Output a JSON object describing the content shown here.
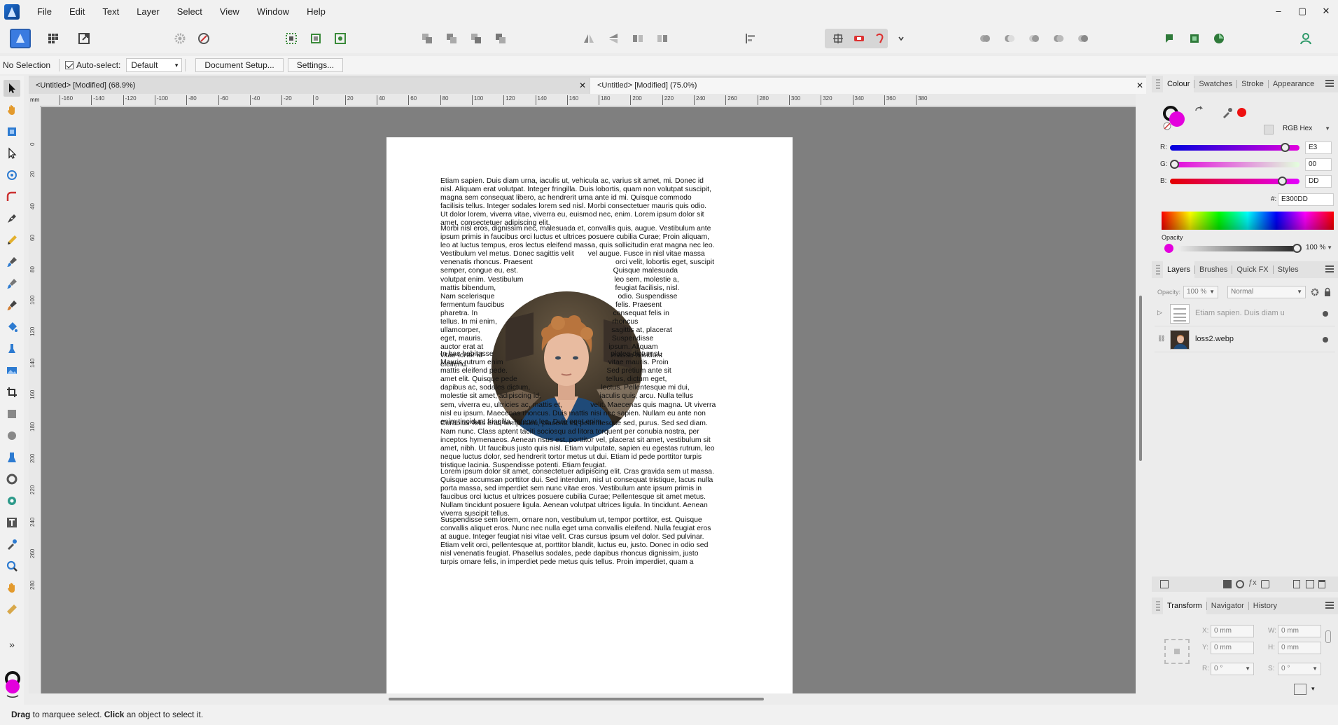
{
  "menubar": {
    "items": [
      "File",
      "Edit",
      "Text",
      "Layer",
      "Select",
      "View",
      "Window",
      "Help"
    ],
    "window_controls": [
      "–",
      "▢",
      "✕"
    ]
  },
  "context_bar": {
    "selection": "No Selection",
    "autoselect_label": "Auto-select:",
    "autoselect_value": "Default",
    "document_setup": "Document Setup...",
    "settings": "Settings..."
  },
  "tabs": [
    {
      "title": "<Untitled> [Modified] (68.9%)",
      "close": "✕"
    },
    {
      "title": "<Untitled> [Modified] (75.0%)",
      "close": "✕"
    }
  ],
  "ruler": {
    "unit": "mm",
    "h_ticks": [
      "-160",
      "-140",
      "-120",
      "-100",
      "-80",
      "-60",
      "-40",
      "-20",
      "0",
      "20",
      "40",
      "60",
      "80",
      "100",
      "120",
      "140",
      "160",
      "180",
      "200",
      "220",
      "240",
      "260",
      "280",
      "300",
      "320",
      "340",
      "360",
      "380"
    ],
    "v_ticks": [
      "0",
      "20",
      "40",
      "60",
      "80",
      "100",
      "120",
      "140",
      "160",
      "180",
      "200",
      "220",
      "240",
      "260",
      "280"
    ]
  },
  "document": {
    "paragraphs": [
      [
        "Etiam sapien. Duis diam urna, iaculis ut, vehicula ac, varius sit amet, mi. Donec id",
        "nisl. Aliquam erat volutpat. Integer fringilla. Duis lobortis, quam non volutpat suscipit,",
        "magna sem consequat libero, ac hendrerit urna ante id mi. Quisque commodo",
        "facilisis tellus. Integer sodales lorem sed nisl. Morbi consectetuer mauris quis odio.",
        "Ut dolor lorem, viverra vitae, viverra eu, euismod nec, enim. Lorem ipsum dolor sit",
        "amet, consectetuer adipiscing elit."
      ],
      [
        "Morbi nisl eros, dignissim nec, malesuada et, convallis quis, augue. Vestibulum ante",
        "ipsum primis in faucibus orci luctus et ultrices posuere cubilia Curae; Proin aliquam,",
        "leo at luctus tempus, eros lectus eleifend massa, quis sollicitudin erat magna nec leo.",
        "Vestibulum vel metus. Donec sagittis velit       vel augue. Fusce in nisl vitae massa",
        "venenatis rhoncus. Praesent                                         orci velit, lobortis eget, suscipit",
        "semper, congue eu, est.                                               Quisque malesuada",
        "volutpat enim. Vestibulum                                             leo sem, molestie a,",
        "mattis bibendum,                                                           feugiat facilisis, nisl.",
        "Nam scelerisque                                                             odio. Suspendisse",
        "fermentum faucibus                                                       felis. Praesent",
        "pharetra. In                                                                   consequat felis in",
        "tellus. In mi enim,                                                         rhoncus",
        "ullamcorper,                                                                 sagittis at, placerat",
        "eget, mauris.                                                                Suspendisse",
        "auctor erat at                                                              ipsum. Aliquam",
        "vitae tortor id                                                                massa tincidunt",
        "eleifend."
      ],
      [
        "In hac habitasse                                                          platea dictumst.",
        "Mauris rutrum enim                                                    vitae mauris. Proin",
        "mattis eleifend pede.                                                 Sed pretium ante sit",
        "amet elit. Quisque pede                                            tellus, dictum eget,",
        "dapibus ac, sodales dictum,                                   lectus. Pellentesque mi dui,",
        "molestie sit amet, adipiscing id,                             iaculis quis, arcu. Nulla tellus",
        "sem, viverra eu, ultricies ac, mattis et,              velit. Maecenas quis magna. Ut viverra",
        "nisl eu ipsum. Maecenas rhoncus. Duis mattis nisi nec sapien. Nullam eu ante non",
        "enim tincidunt fringilla. Integer leo. Duis eget enim."
      ],
      [
        "Curabitur felis erat, tempus eu, placerat et, pellentesque sed, purus. Sed sed diam.",
        "Nam nunc. Class aptent taciti sociosqu ad litora torquent per conubia nostra, per",
        "inceptos hymenaeos. Aenean risus est, porttitor vel, placerat sit amet, vestibulum sit",
        "amet, nibh. Ut faucibus justo quis nisl. Etiam vulputate, sapien eu egestas rutrum, leo",
        "neque luctus dolor, sed hendrerit tortor metus ut dui. Etiam id pede porttitor turpis",
        "tristique lacinia. Suspendisse potenti. Etiam feugiat."
      ],
      [
        "Lorem ipsum dolor sit amet, consectetuer adipiscing elit. Cras gravida sem ut massa.",
        "Quisque accumsan porttitor dui. Sed interdum, nisl ut consequat tristique, lacus nulla",
        "porta massa, sed imperdiet sem nunc vitae eros. Vestibulum ante ipsum primis in",
        "faucibus orci luctus et ultrices posuere cubilia Curae; Pellentesque sit amet metus.",
        "Nullam tincidunt posuere ligula. Aenean volutpat ultrices ligula. In tincidunt. Aenean",
        "viverra suscipit tellus."
      ],
      [
        "Suspendisse sem lorem, ornare non, vestibulum ut, tempor porttitor, est. Quisque",
        "convallis aliquet eros. Nunc nec nulla eget urna convallis eleifend. Nulla feugiat eros",
        "at augue. Integer feugiat nisi vitae velit. Cras cursus ipsum vel dolor. Sed pulvinar.",
        "Etiam velit orci, pellentesque at, porttitor blandit, luctus eu, justo. Donec in odio sed",
        "nisl venenatis feugiat. Phasellus sodales, pede dapibus rhoncus dignissim, justo",
        "turpis ornare felis, in imperdiet pede metus quis tellus. Proin imperdiet, quam a"
      ]
    ]
  },
  "colour_panel": {
    "tabs": [
      "Colour",
      "Swatches",
      "Stroke",
      "Appearance"
    ],
    "model": "RGB Hex",
    "channels": [
      {
        "label": "R:",
        "value": "E3",
        "level": 0.89
      },
      {
        "label": "G:",
        "value": "00",
        "level": 0.0
      },
      {
        "label": "B:",
        "value": "DD",
        "level": 0.867
      }
    ],
    "hex_label": "#:",
    "hex": "E300DD",
    "opacity_label": "Opacity",
    "opacity": "100 %",
    "fill_color": "#e300dd",
    "stroke_color": "#111111",
    "accent_red": "#ee1111"
  },
  "layers_panel": {
    "tabs": [
      "Layers",
      "Brushes",
      "Quick FX",
      "Styles"
    ],
    "opacity_label": "Opacity:",
    "opacity": "100 %",
    "blend": "Normal",
    "layers": [
      {
        "name": "Etiam sapien. Duis diam u",
        "type": "text"
      },
      {
        "name": "loss2.webp",
        "type": "image"
      }
    ]
  },
  "transform_panel": {
    "tabs": [
      "Transform",
      "Navigator",
      "History"
    ],
    "fields": [
      {
        "label": "X:",
        "value": "0 mm"
      },
      {
        "label": "W:",
        "value": "0 mm"
      },
      {
        "label": "Y:",
        "value": "0 mm"
      },
      {
        "label": "H:",
        "value": "0 mm"
      },
      {
        "label": "R:",
        "value": "0 °"
      },
      {
        "label": "S:",
        "value": "0 °"
      }
    ]
  },
  "status": {
    "bold1": "Drag",
    "text1": " to marquee select. ",
    "bold2": "Click",
    "text2": " an object to select it."
  }
}
